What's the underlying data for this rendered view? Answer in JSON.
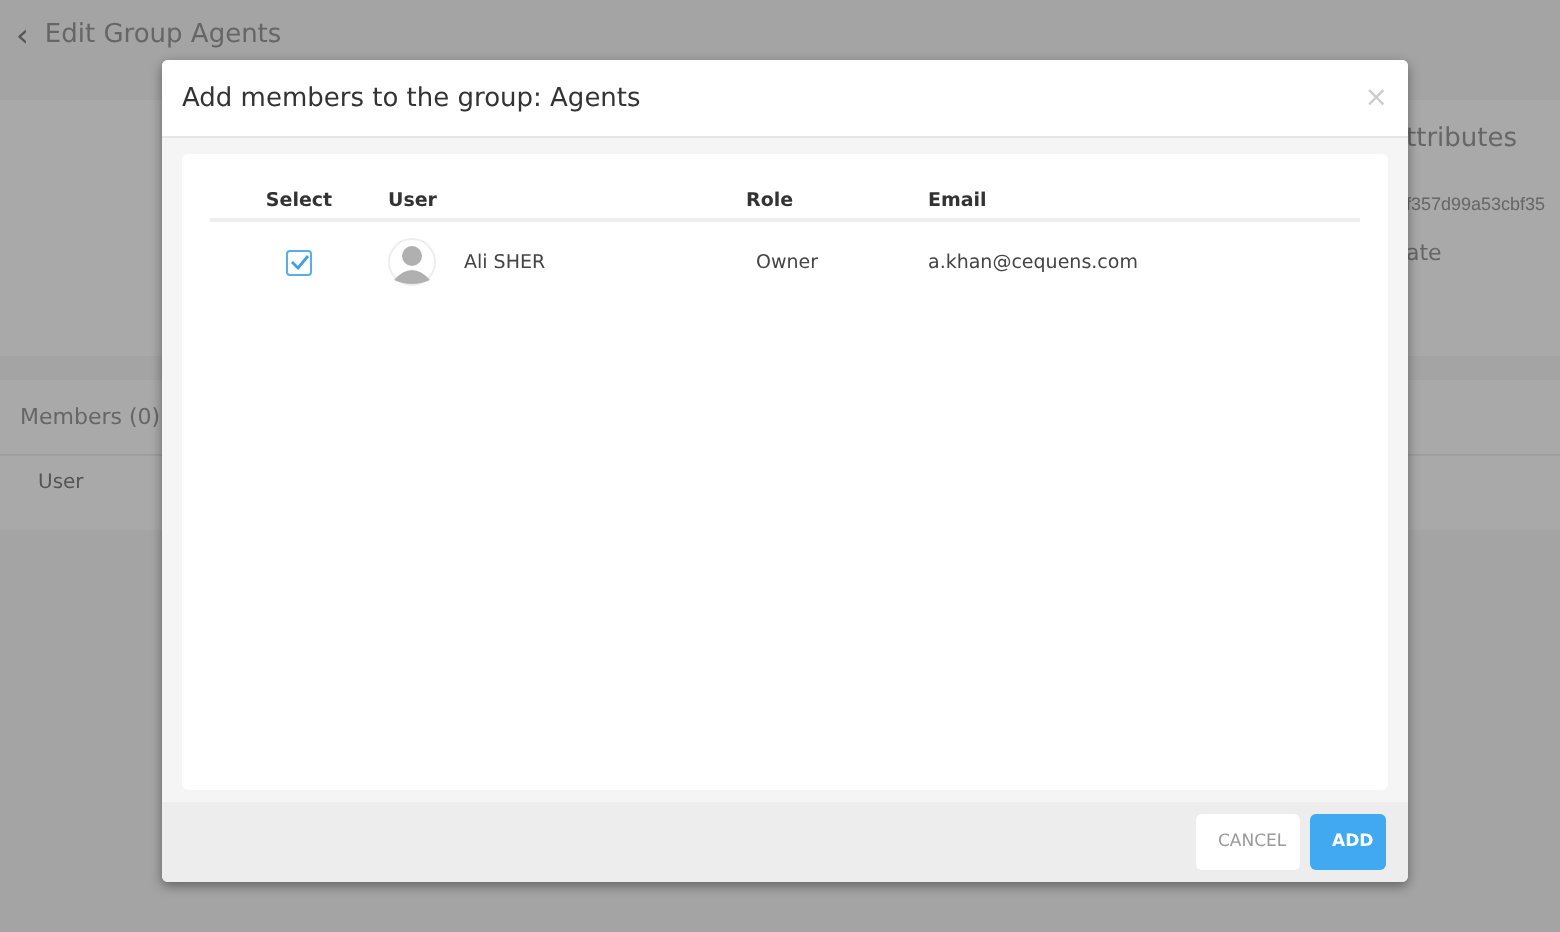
{
  "page": {
    "back": "‹",
    "title": "Edit Group Agents",
    "attributes_title": "ttributes",
    "attributes_id": "f357d99a53cbf35",
    "attributes_field": "ate",
    "members_title": "Members (0)",
    "members_column": "User"
  },
  "dialog": {
    "title": "Add members to the group: Agents",
    "close": "×",
    "columns": [
      "Select",
      "User",
      "Role",
      "Email"
    ],
    "rows": [
      {
        "selected": true,
        "user": "Ali SHER",
        "role": "Owner",
        "email": "a.khan@cequens.com"
      }
    ],
    "buttons": [
      {
        "label": "CANCEL",
        "kind": "secondary"
      },
      {
        "label": "ADD",
        "kind": "primary"
      }
    ]
  }
}
